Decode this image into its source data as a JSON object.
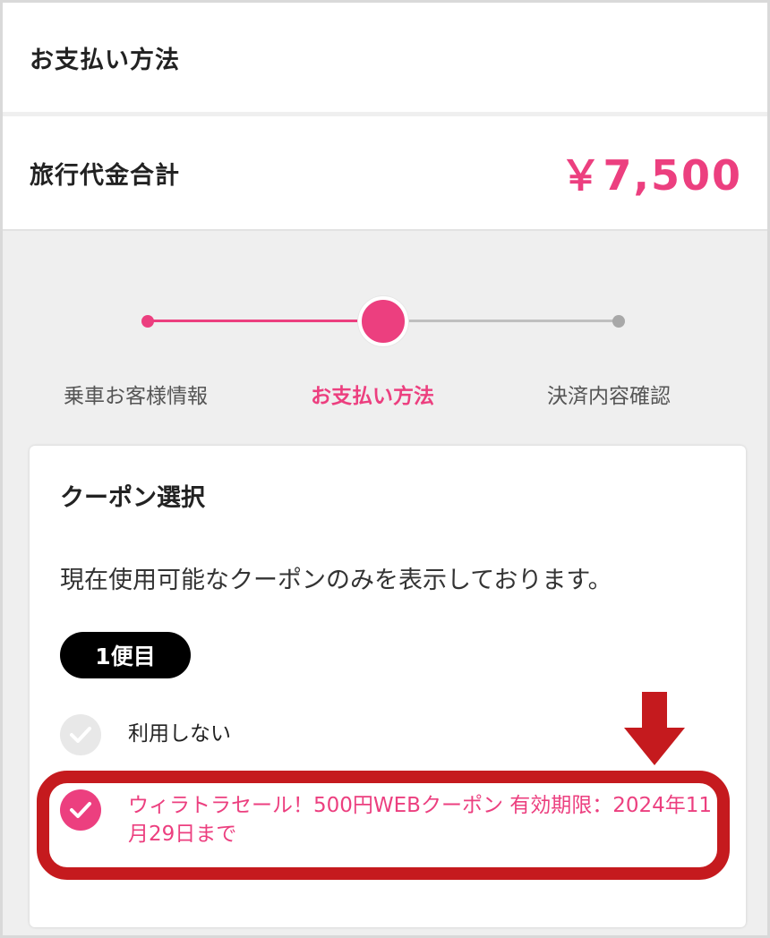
{
  "header": {
    "title": "お支払い方法"
  },
  "total": {
    "label": "旅行代金合計",
    "amount": "￥7,500"
  },
  "stepper": {
    "steps": [
      {
        "label": "乗車お客様情報",
        "state": "done"
      },
      {
        "label": "お支払い方法",
        "state": "current"
      },
      {
        "label": "決済内容確認",
        "state": "todo"
      }
    ]
  },
  "coupon": {
    "title": "クーポン選択",
    "note": "現在使用可能なクーポンのみを表示しております。",
    "flight_badge": "1便目",
    "options": [
      {
        "label": "利用しない",
        "selected": false
      },
      {
        "label": "ウィラトラセール！500円WEBクーポン 有効期限：2024年11月29日まで",
        "selected": true
      }
    ]
  },
  "colors": {
    "accent": "#ec3f7f",
    "highlight": "#c51a1e"
  }
}
